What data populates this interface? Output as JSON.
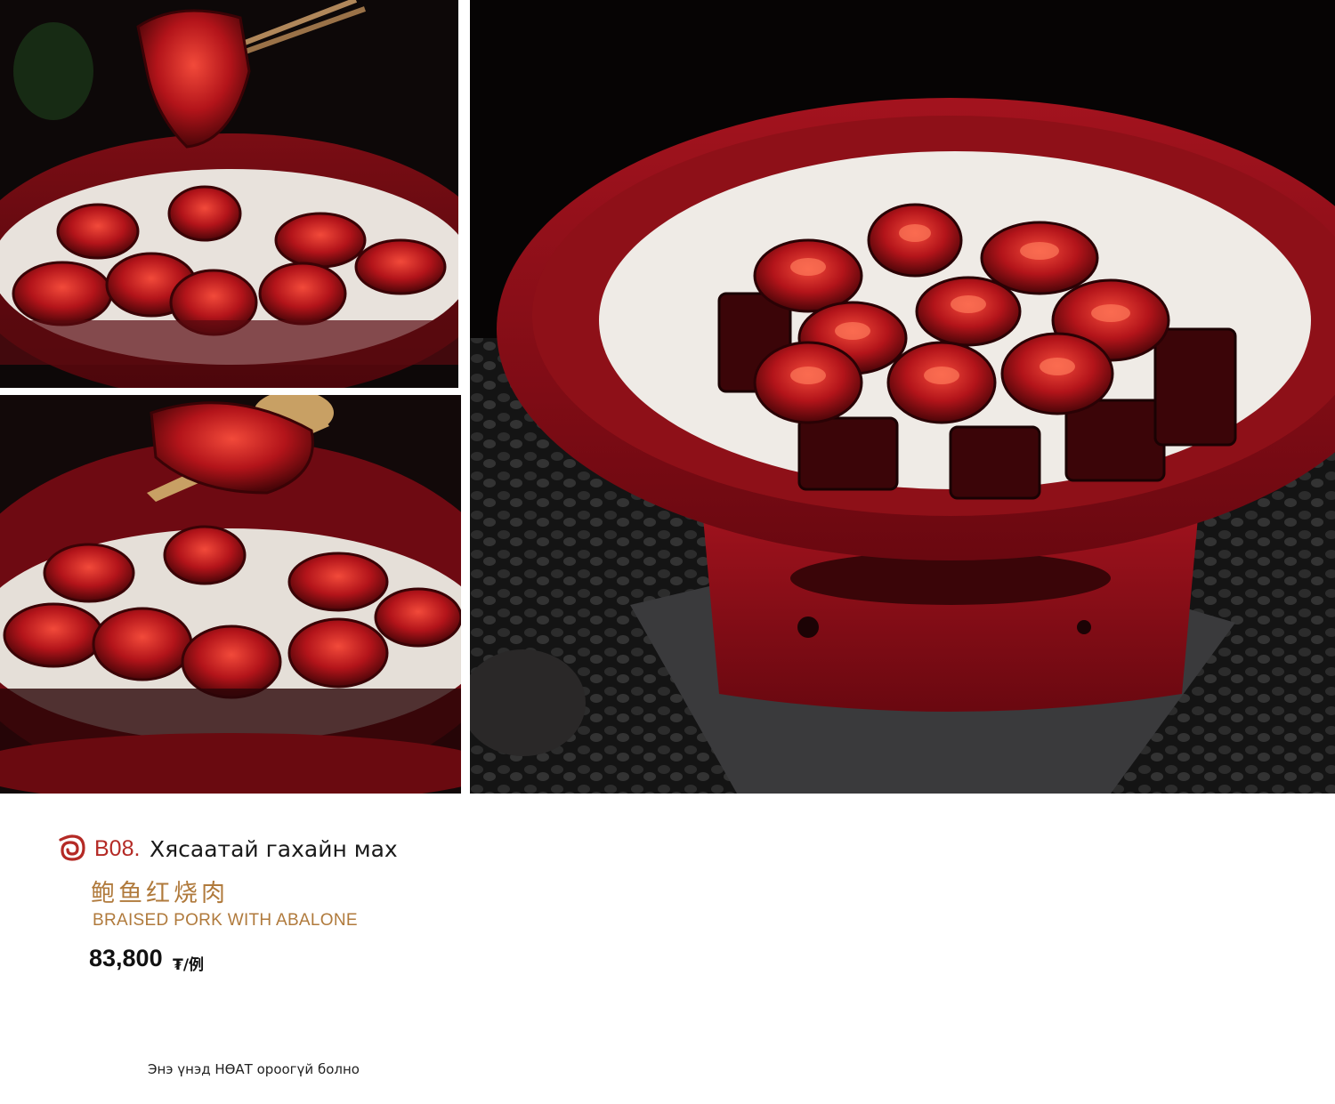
{
  "dish": {
    "code": "B08.",
    "name_mn": "Хясаатай гахайн мах",
    "name_cn": "鲍鱼红烧肉",
    "name_en": "BRAISED PORK WITH ABALONE",
    "price": "83,800",
    "price_unit": "₮/例"
  },
  "footer": {
    "vat_note": "Энэ үнэд НӨАТ ороогүй болно"
  },
  "images": [
    {
      "subject": "abalone braised pork held with chopsticks"
    },
    {
      "subject": "abalone lifted with golden fork"
    },
    {
      "subject": "abalone braised pork in red bowl on stand"
    }
  ],
  "decor": {
    "accent": "#b42a25",
    "gold": "#b07a3c",
    "bowl_red": "#8e1018"
  }
}
